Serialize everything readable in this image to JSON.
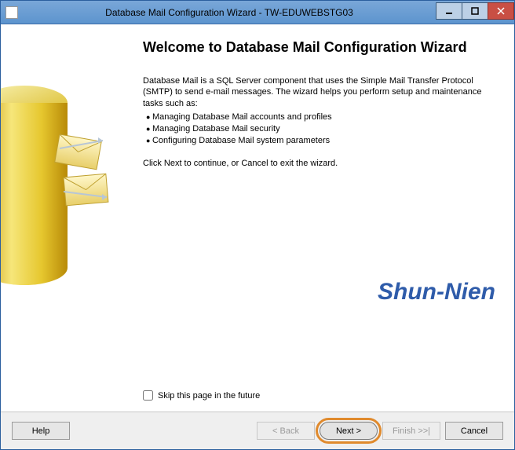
{
  "window": {
    "title": "Database Mail Configuration Wizard - TW-EDUWEBSTG03"
  },
  "content": {
    "heading": "Welcome to Database Mail Configuration Wizard",
    "intro": "Database Mail is a SQL Server component that uses the Simple Mail Transfer Protocol (SMTP) to send e-mail messages. The wizard helps you perform setup and maintenance tasks such as:",
    "bullets": [
      "Managing Database Mail accounts and profiles",
      "Managing Database Mail security",
      "Configuring Database Mail system parameters"
    ],
    "continue_hint": "Click Next to continue, or Cancel to exit the wizard.",
    "watermark": "Shun-Nien",
    "skip_label": "Skip this page in the future"
  },
  "footer": {
    "help": "Help",
    "back": "< Back",
    "next": "Next >",
    "finish": "Finish >>|",
    "cancel": "Cancel"
  }
}
